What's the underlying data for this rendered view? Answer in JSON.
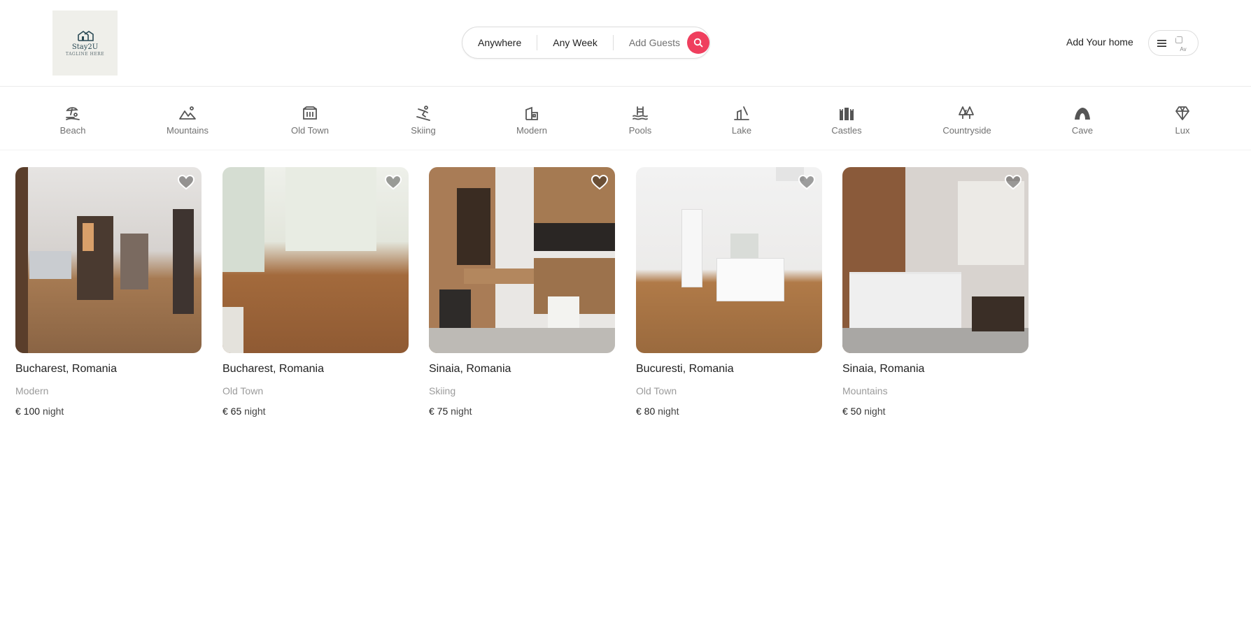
{
  "logo": {
    "name": "Stay2U",
    "tagline": "TAGLINE HERE"
  },
  "search": {
    "where": "Anywhere",
    "when": "Any Week",
    "guests": "Add Guests",
    "accent_color": "#ef3f5e",
    "icon": "search-icon"
  },
  "header": {
    "add_home": "Add Your home",
    "menu_icon": "hamburger-icon",
    "avatar_alt": "Av"
  },
  "categories": [
    {
      "label": "Beach",
      "icon": "beach-icon"
    },
    {
      "label": "Mountains",
      "icon": "mountains-icon"
    },
    {
      "label": "Old Town",
      "icon": "old-town-icon"
    },
    {
      "label": "Skiing",
      "icon": "skiing-icon"
    },
    {
      "label": "Modern",
      "icon": "modern-icon"
    },
    {
      "label": "Pools",
      "icon": "pools-icon"
    },
    {
      "label": "Lake",
      "icon": "lake-icon"
    },
    {
      "label": "Castles",
      "icon": "castles-icon"
    },
    {
      "label": "Countryside",
      "icon": "countryside-icon"
    },
    {
      "label": "Cave",
      "icon": "cave-icon"
    },
    {
      "label": "Lux",
      "icon": "lux-icon"
    }
  ],
  "listings": [
    {
      "location": "Bucharest, Romania",
      "category": "Modern",
      "price": "€ 100",
      "unit": "night"
    },
    {
      "location": "Bucharest, Romania",
      "category": "Old Town",
      "price": "€ 65",
      "unit": "night"
    },
    {
      "location": "Sinaia, Romania",
      "category": "Skiing",
      "price": "€ 75",
      "unit": "night"
    },
    {
      "location": "Bucuresti, Romania",
      "category": "Old Town",
      "price": "€ 80",
      "unit": "night"
    },
    {
      "location": "Sinaia, Romania",
      "category": "Mountains",
      "price": "€ 50",
      "unit": "night"
    }
  ]
}
